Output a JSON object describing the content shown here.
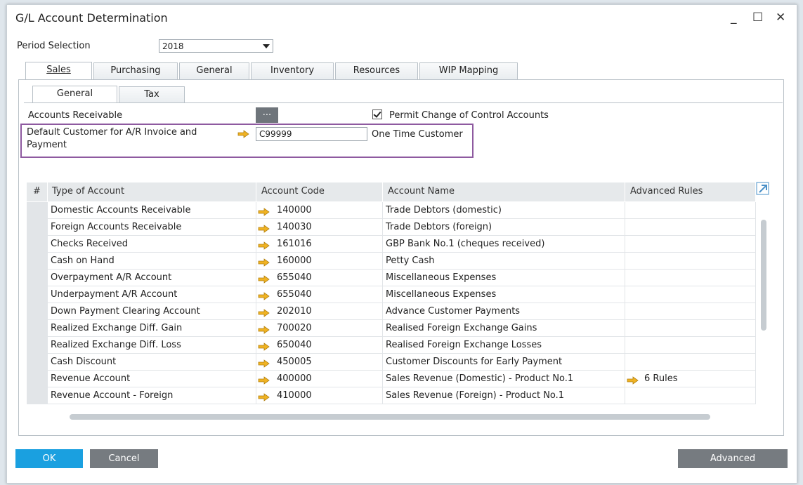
{
  "window": {
    "title": "G/L Account Determination",
    "controls": [
      "_",
      "☐",
      "✕"
    ]
  },
  "period": {
    "label": "Period Selection",
    "value": "2018"
  },
  "main_tabs": [
    "Sales",
    "Purchasing",
    "General",
    "Inventory",
    "Resources",
    "WIP Mapping"
  ],
  "sub_tabs": [
    "General",
    "Tax"
  ],
  "accounts_receivable": {
    "label": "Accounts Receivable",
    "button_label": "..."
  },
  "permit_change": {
    "label": "Permit Change of Control Accounts",
    "checked": true
  },
  "default_customer": {
    "label_line1": "Default Customer for A/R Invoice and",
    "label_line2": "Payment",
    "code": "C99999",
    "name": "One Time Customer"
  },
  "table": {
    "headers": [
      "#",
      "Type of Account",
      "Account Code",
      "Account Name",
      "Advanced Rules"
    ],
    "rows": [
      {
        "type": "Domestic Accounts Receivable",
        "code": "140000",
        "name": "Trade Debtors (domestic)",
        "rules": ""
      },
      {
        "type": "Foreign Accounts Receivable",
        "code": "140030",
        "name": "Trade Debtors (foreign)",
        "rules": ""
      },
      {
        "type": "Checks Received",
        "code": "161016",
        "name": "GBP Bank No.1 (cheques received)",
        "rules": ""
      },
      {
        "type": "Cash on Hand",
        "code": "160000",
        "name": "Petty Cash",
        "rules": ""
      },
      {
        "type": "Overpayment A/R Account",
        "code": "655040",
        "name": "Miscellaneous Expenses",
        "rules": ""
      },
      {
        "type": "Underpayment A/R Account",
        "code": "655040",
        "name": "Miscellaneous Expenses",
        "rules": ""
      },
      {
        "type": "Down Payment Clearing Account",
        "code": "202010",
        "name": "Advance Customer Payments",
        "rules": ""
      },
      {
        "type": "Realized Exchange Diff. Gain",
        "code": "700020",
        "name": "Realised Foreign Exchange Gains",
        "rules": ""
      },
      {
        "type": "Realized Exchange Diff. Loss",
        "code": "650040",
        "name": "Realised Foreign Exchange Losses",
        "rules": ""
      },
      {
        "type": "Cash Discount",
        "code": "450005",
        "name": "Customer Discounts for Early Payment",
        "rules": ""
      },
      {
        "type": "Revenue Account",
        "code": "400000",
        "name": "Sales Revenue (Domestic) - Product No.1",
        "rules": "6 Rules"
      },
      {
        "type": "Revenue Account - Foreign",
        "code": "410000",
        "name": "Sales Revenue (Foreign) - Product No.1",
        "rules": ""
      }
    ]
  },
  "buttons": {
    "ok": "OK",
    "cancel": "Cancel",
    "advanced": "Advanced"
  },
  "colors": {
    "ok_button": "#1aa0e0",
    "secondary_button": "#767b80",
    "highlight_box": "#8e5aa0",
    "link_arrow": "#f0b323"
  }
}
